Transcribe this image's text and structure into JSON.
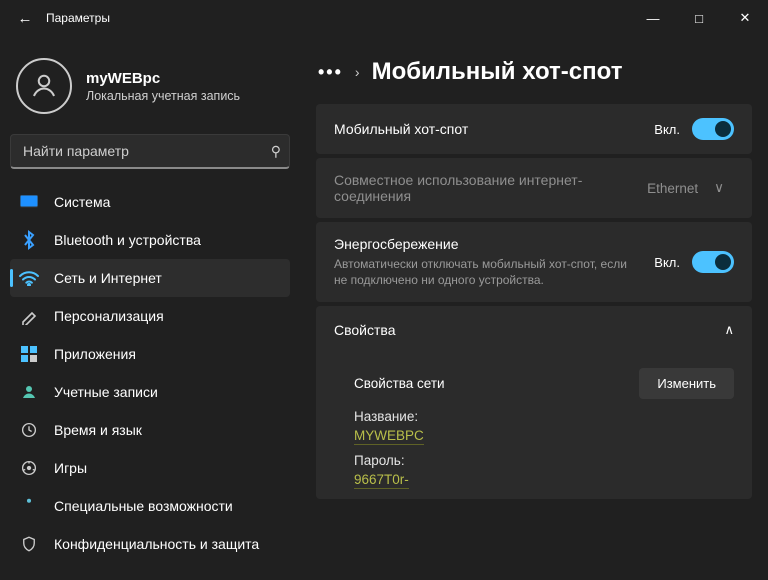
{
  "window": {
    "title": "Параметры"
  },
  "profile": {
    "name": "myWEBpc",
    "subtitle": "Локальная учетная запись"
  },
  "search": {
    "placeholder": "Найти параметр"
  },
  "sidebar": {
    "items": [
      {
        "label": "Система",
        "color": "#1e90ff"
      },
      {
        "label": "Bluetooth и устройства",
        "color": "#1e90ff"
      },
      {
        "label": "Сеть и Интернет",
        "color": "#4cc2ff",
        "active": true
      },
      {
        "label": "Персонализация",
        "color": "#ccc"
      },
      {
        "label": "Приложения",
        "color": "#ccc"
      },
      {
        "label": "Учетные записи",
        "color": "#55c6b2"
      },
      {
        "label": "Время и язык",
        "color": "#ccc"
      },
      {
        "label": "Игры",
        "color": "#ccc"
      },
      {
        "label": "Специальные возможности",
        "color": "#5ec0d8"
      },
      {
        "label": "Конфиденциальность и защита",
        "color": "#ccc"
      }
    ]
  },
  "page": {
    "crumb_dots": "•••",
    "title": "Мобильный хот-спот",
    "rows": {
      "hotspot": {
        "label": "Мобильный хот-спот",
        "state": "Вкл."
      },
      "share": {
        "label": "Совместное использование интернет-соединения",
        "select": "Ethernet"
      },
      "power": {
        "label": "Энергосбережение",
        "sub": "Автоматически отключать мобильный хот-спот, если не подключено ни одного устройства.",
        "state": "Вкл."
      }
    },
    "properties": {
      "header": "Свойства",
      "section": "Свойства сети",
      "edit": "Изменить",
      "name_label": "Название:",
      "name_value": "MYWEBPC",
      "pass_label": "Пароль:",
      "pass_value": "9667T0r-"
    }
  }
}
